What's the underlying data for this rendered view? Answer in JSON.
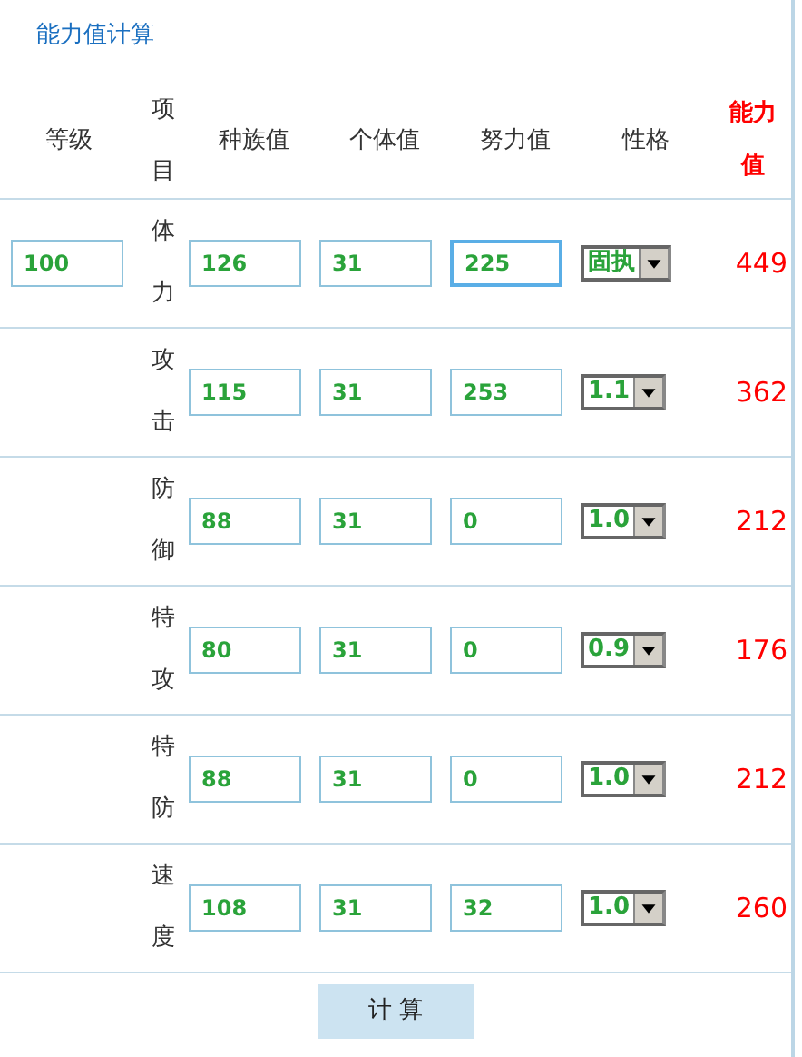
{
  "title": "能力值计算",
  "columns": [
    "等级",
    "项目",
    "种族值",
    "个体值",
    "努力值",
    "性格",
    "能力值"
  ],
  "level": {
    "value": "100"
  },
  "rows": [
    {
      "stat": "体力",
      "base": "126",
      "iv": "31",
      "ev": "225",
      "ev_focused": true,
      "nature": "固执",
      "result": "449"
    },
    {
      "stat": "攻击",
      "base": "115",
      "iv": "31",
      "ev": "253",
      "ev_focused": false,
      "nature": "1.1",
      "result": "362"
    },
    {
      "stat": "防御",
      "base": "88",
      "iv": "31",
      "ev": "0",
      "ev_focused": false,
      "nature": "1.0",
      "result": "212"
    },
    {
      "stat": "特攻",
      "base": "80",
      "iv": "31",
      "ev": "0",
      "ev_focused": false,
      "nature": "0.9",
      "result": "176"
    },
    {
      "stat": "特防",
      "base": "88",
      "iv": "31",
      "ev": "0",
      "ev_focused": false,
      "nature": "1.0",
      "result": "212"
    },
    {
      "stat": "速度",
      "base": "108",
      "iv": "31",
      "ev": "32",
      "ev_focused": false,
      "nature": "1.0",
      "result": "260"
    }
  ],
  "button": "计 算"
}
